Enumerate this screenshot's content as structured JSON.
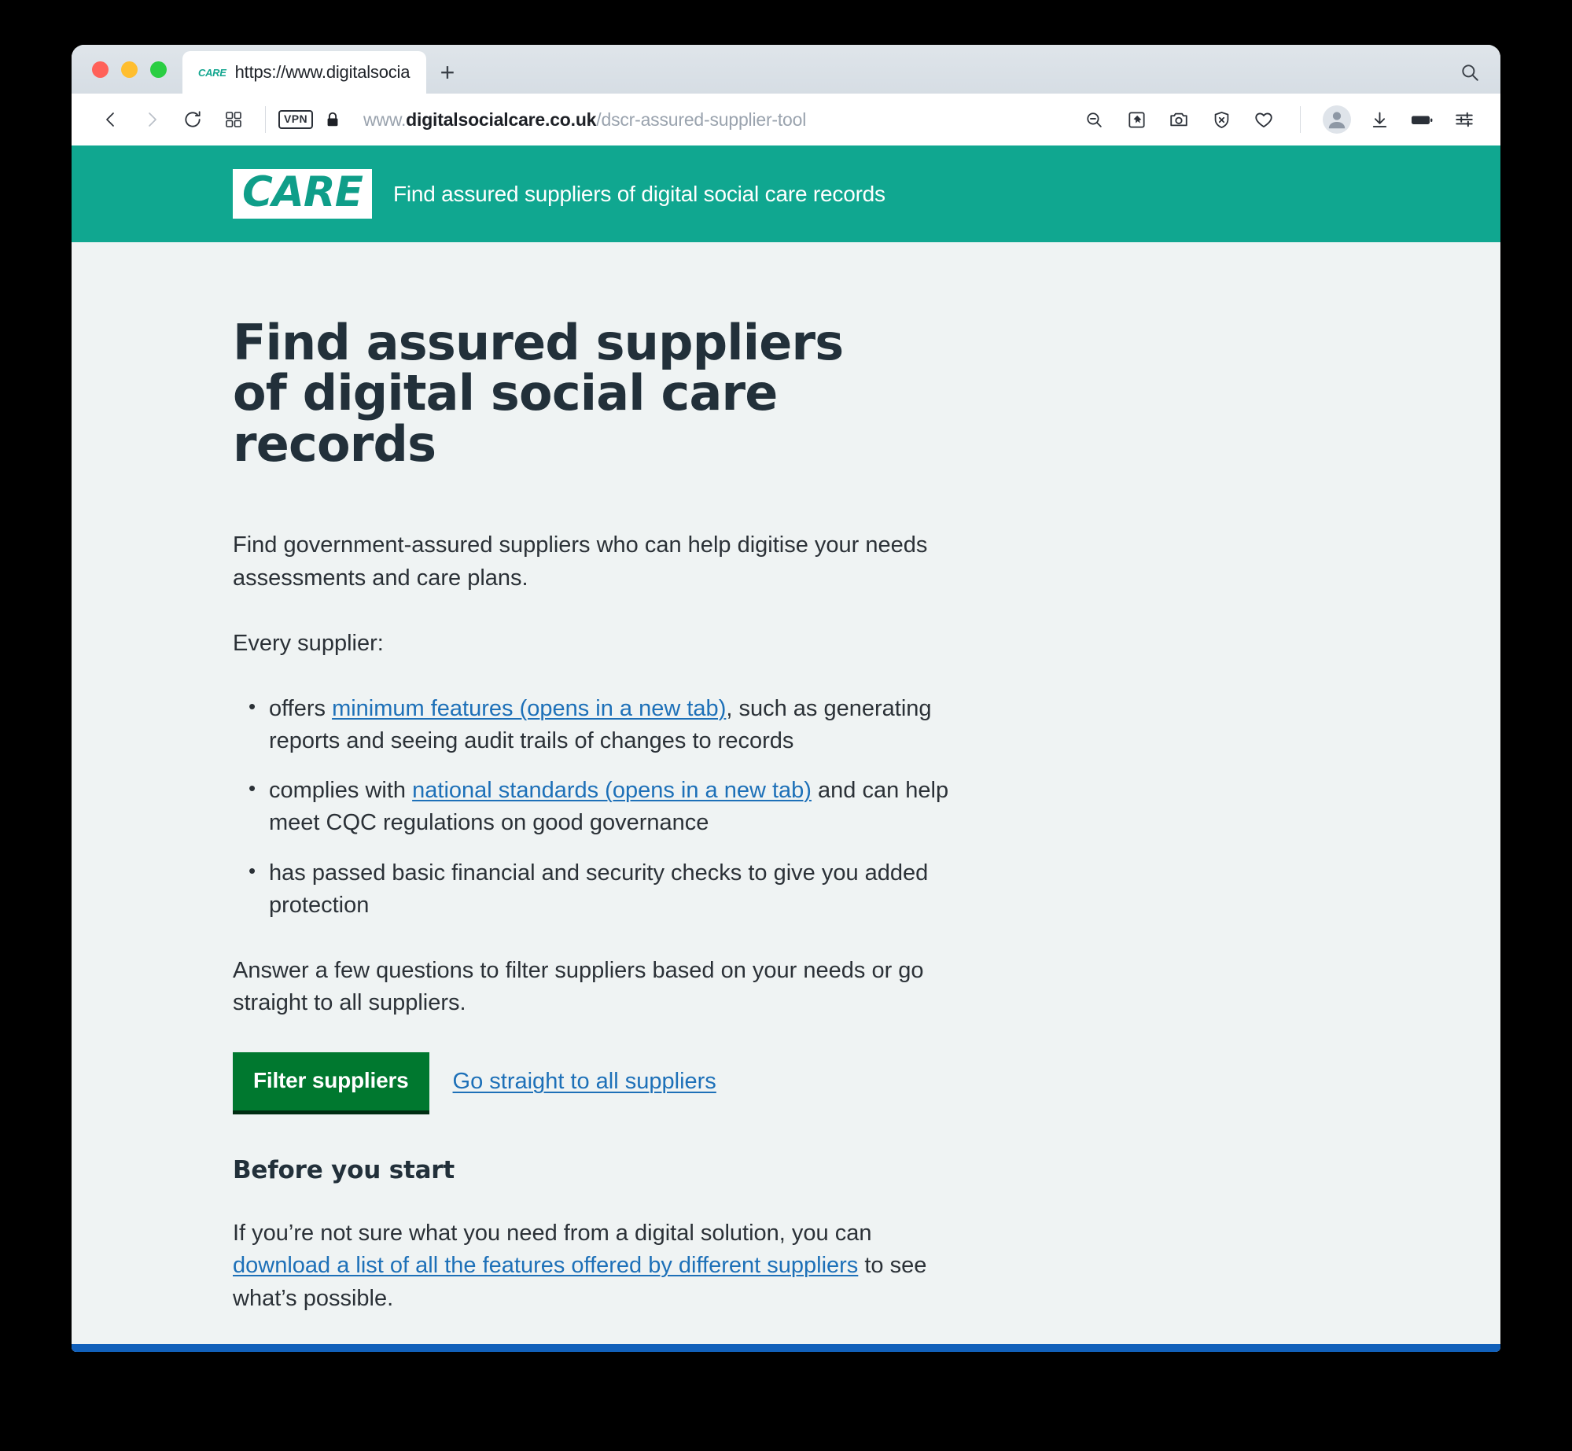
{
  "browser": {
    "window_controls": [
      "close",
      "minimize",
      "maximize"
    ],
    "tab": {
      "favicon_label": "CARE",
      "title": "https://www.digitalsocialcare.co",
      "new_tab_label": "+"
    },
    "tab_search_icon": "search-icon",
    "toolbar": {
      "back_icon": "back-chevron-icon",
      "forward_icon": "forward-chevron-icon",
      "reload_icon": "reload-icon",
      "tabs_overview_icon": "grid-tabs-icon",
      "vpn_badge": "VPN",
      "lock_icon": "padlock-icon",
      "url_host": "www.digitalsocialcare.co.uk",
      "url_host_prefix": "www.",
      "url_host_bold": "digitalsocialcare.co.uk",
      "url_path": "/dscr-assured-supplier-tool",
      "right_icons": [
        "zoom-out-icon",
        "pin-page-icon",
        "screenshot-camera-icon",
        "shield-block-icon",
        "heart-favorite-icon",
        "profile-avatar-icon",
        "download-icon",
        "reader-battery-icon",
        "settings-sliders-icon"
      ]
    }
  },
  "site": {
    "header": {
      "logo_text": "CARE",
      "title": "Find assured suppliers of digital social care records",
      "background_color": "#10a790"
    },
    "page_title": "Find assured suppliers of digital social care records",
    "intro_paragraph": "Find government-assured suppliers who can help digitise your needs assessments and care plans.",
    "list_lead": "Every supplier:",
    "features": [
      {
        "prefix": "offers ",
        "link": "minimum features (opens in a new tab)",
        "suffix": ", such as generating reports and seeing audit trails of changes to records"
      },
      {
        "prefix": "complies with ",
        "link": "national standards (opens in a new tab)",
        "suffix": " and can help meet CQC regulations on good governance"
      },
      {
        "prefix": "has passed basic financial and security checks to give you added protection",
        "link": "",
        "suffix": ""
      }
    ],
    "answer_paragraph": "Answer a few questions to filter suppliers based on your needs or go straight to all suppliers.",
    "primary_button_label": "Filter suppliers",
    "secondary_link_label": "Go straight to all suppliers",
    "before_you_start_heading": "Before you start",
    "before_you_start": {
      "prefix": "If you’re not sure what you need from a digital solution, you can ",
      "link": "download a list of all the features offered by different suppliers",
      "suffix": " to see what’s possible."
    },
    "colors": {
      "brand_green": "#10a790",
      "button_green": "#00782f",
      "link_blue": "#1d70b8",
      "page_background": "#eff3f3",
      "text": "#2b3137",
      "footer_bar_blue": "#1160ba"
    }
  }
}
